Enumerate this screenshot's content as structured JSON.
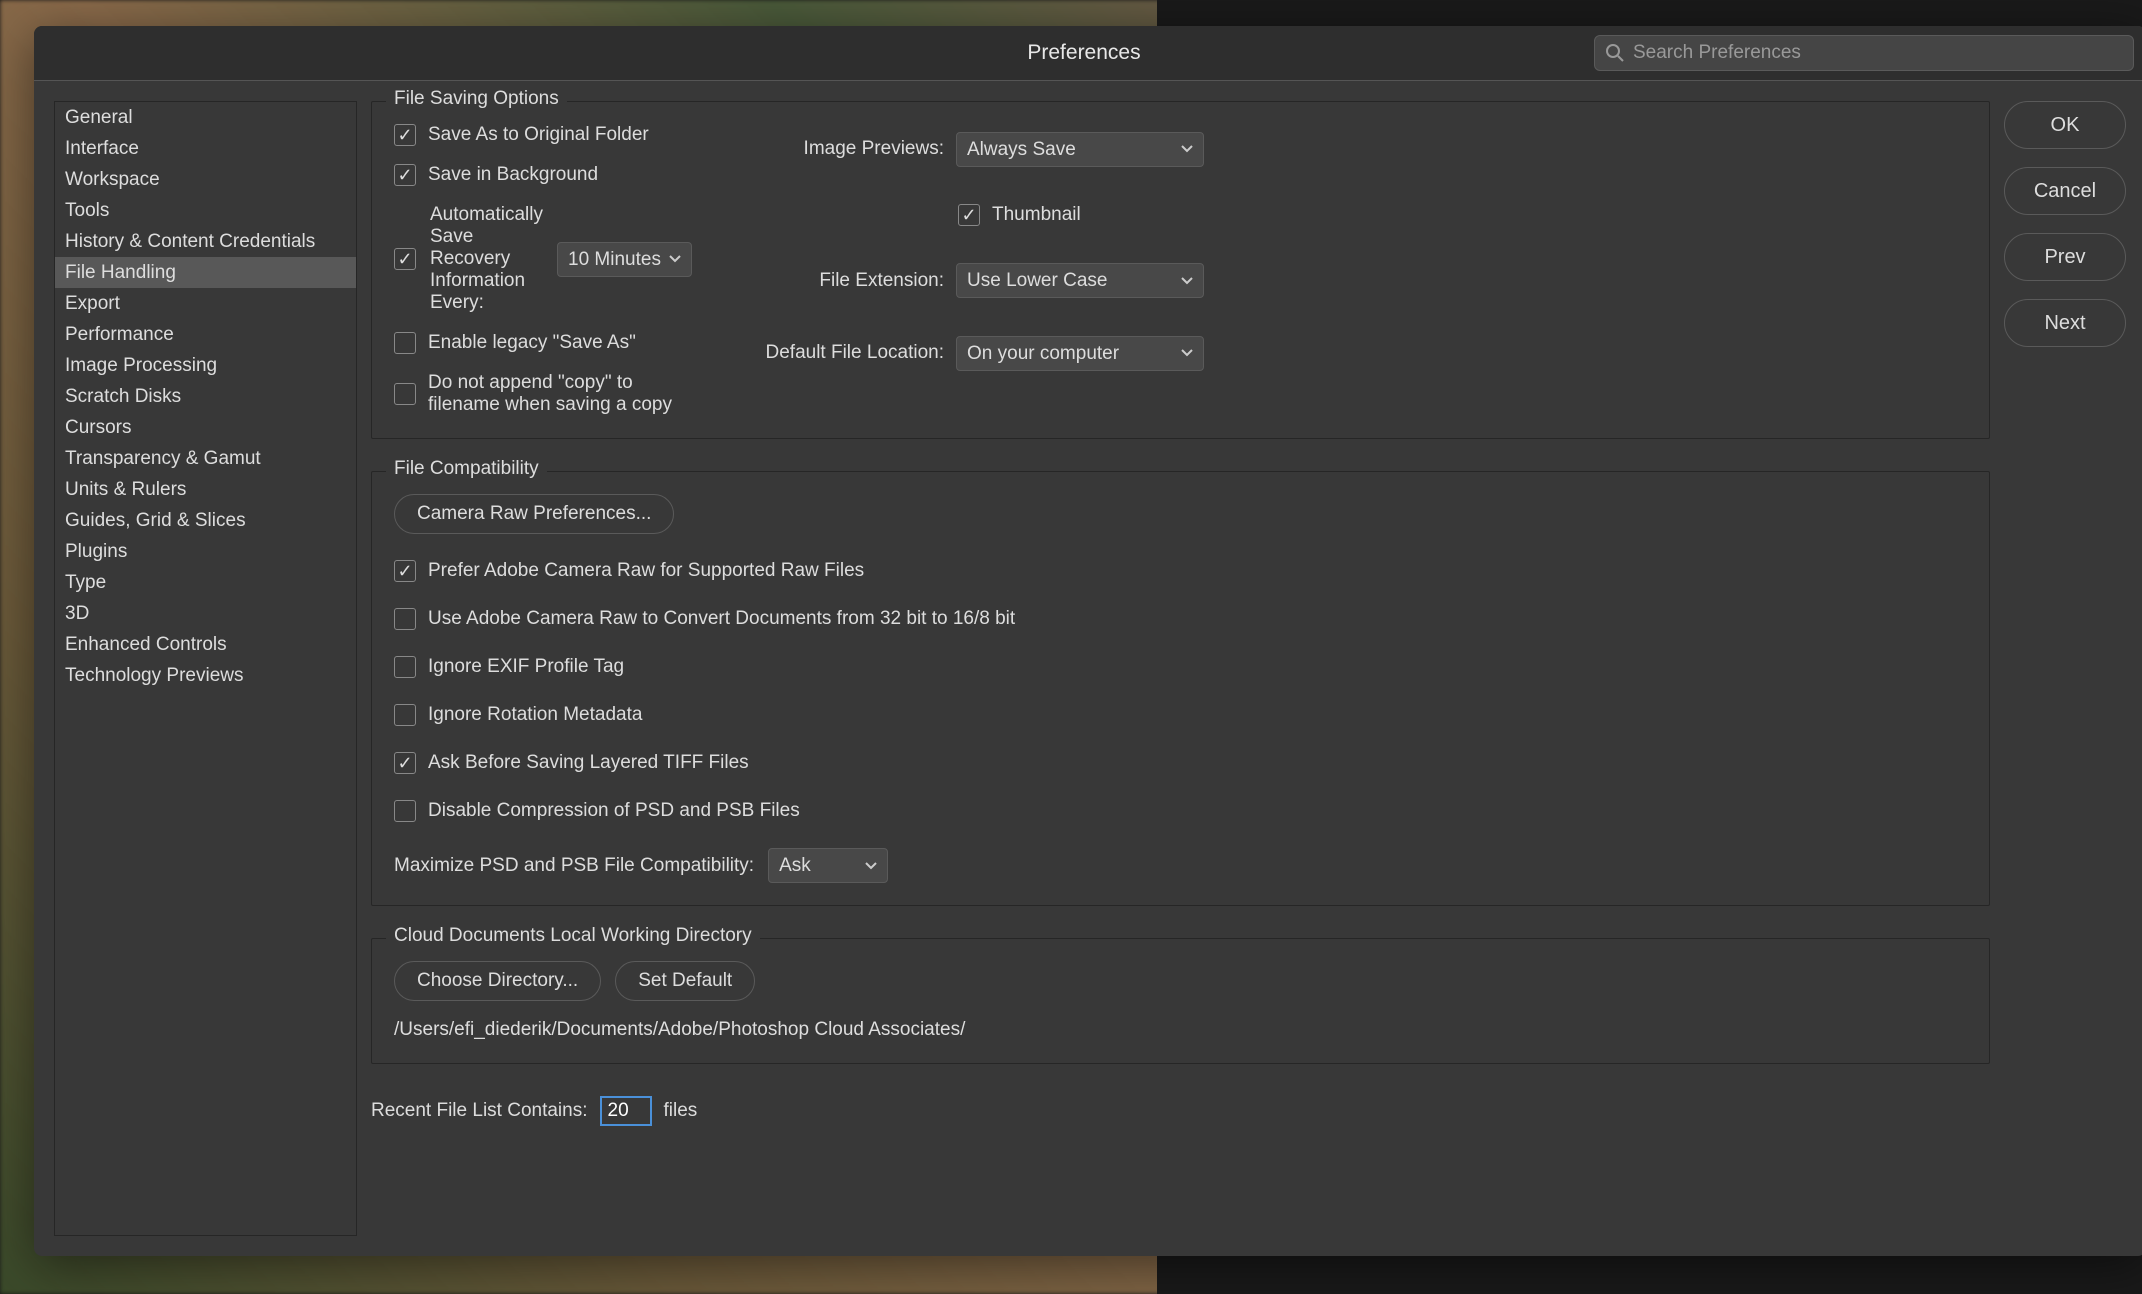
{
  "title": "Preferences",
  "search_placeholder": "Search Preferences",
  "sidebar": {
    "items": [
      "General",
      "Interface",
      "Workspace",
      "Tools",
      "History & Content Credentials",
      "File Handling",
      "Export",
      "Performance",
      "Image Processing",
      "Scratch Disks",
      "Cursors",
      "Transparency & Gamut",
      "Units & Rulers",
      "Guides, Grid & Slices",
      "Plugins",
      "Type",
      "3D",
      "Enhanced Controls",
      "Technology Previews"
    ],
    "selected_index": 5
  },
  "buttons": {
    "ok": "OK",
    "cancel": "Cancel",
    "prev": "Prev",
    "next": "Next"
  },
  "saving": {
    "legend": "File Saving Options",
    "image_previews_label": "Image Previews:",
    "image_previews_value": "Always Save",
    "thumbnail_label": "Thumbnail",
    "thumbnail_checked": true,
    "file_extension_label": "File Extension:",
    "file_extension_value": "Use Lower Case",
    "default_loc_label": "Default File Location:",
    "default_loc_value": "On your computer",
    "save_original_label": "Save As to Original Folder",
    "save_original_checked": true,
    "save_bg_label": "Save in Background",
    "save_bg_checked": true,
    "auto_recov_checked": true,
    "auto_recov_label": "Automatically Save Recovery Information Every:",
    "auto_recov_value": "10 Minutes",
    "legacy_label": "Enable legacy \"Save As\"",
    "legacy_checked": false,
    "noappend_label": "Do not append \"copy\" to filename when saving a copy",
    "noappend_checked": false
  },
  "compat": {
    "legend": "File Compatibility",
    "camera_raw_btn": "Camera Raw Preferences...",
    "prefer_acr_label": "Prefer Adobe Camera Raw for Supported Raw Files",
    "prefer_acr_checked": true,
    "convert_label": "Use Adobe Camera Raw to Convert Documents from 32 bit to 16/8 bit",
    "convert_checked": false,
    "exif_label": "Ignore EXIF Profile Tag",
    "exif_checked": false,
    "rotation_label": "Ignore Rotation Metadata",
    "rotation_checked": false,
    "tiff_label": "Ask Before Saving Layered TIFF Files",
    "tiff_checked": true,
    "compress_label": "Disable Compression of PSD and PSB Files",
    "compress_checked": false,
    "max_label": "Maximize PSD and PSB File Compatibility:",
    "max_value": "Ask"
  },
  "cloud": {
    "legend": "Cloud Documents Local Working Directory",
    "choose_btn": "Choose Directory...",
    "set_default_btn": "Set Default",
    "path": "/Users/efi_diederik/Documents/Adobe/Photoshop Cloud Associates/"
  },
  "recent": {
    "label": "Recent File List Contains:",
    "value": "20",
    "suffix": "files"
  }
}
